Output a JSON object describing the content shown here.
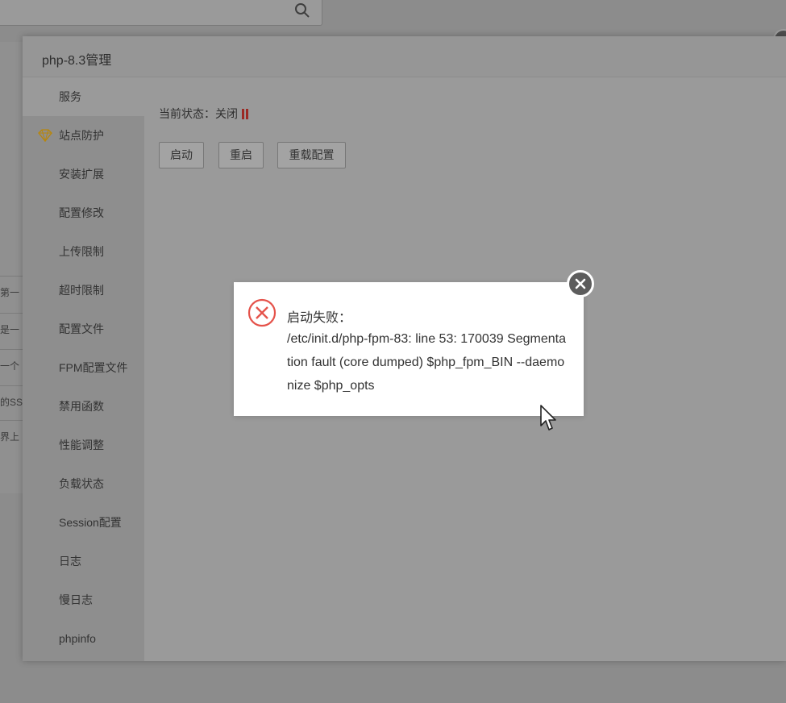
{
  "background": {
    "left_rows": [
      "第一",
      "是一",
      "一个",
      "的SS",
      "界上"
    ]
  },
  "modal": {
    "title": "php-8.3管理",
    "sidebar_items": [
      {
        "label": "服务"
      },
      {
        "label": "站点防护"
      },
      {
        "label": "安装扩展"
      },
      {
        "label": "配置修改"
      },
      {
        "label": "上传限制"
      },
      {
        "label": "超时限制"
      },
      {
        "label": "配置文件"
      },
      {
        "label": "FPM配置文件"
      },
      {
        "label": "禁用函数"
      },
      {
        "label": "性能调整"
      },
      {
        "label": "负载状态"
      },
      {
        "label": "Session配置"
      },
      {
        "label": "日志"
      },
      {
        "label": "慢日志"
      },
      {
        "label": "phpinfo"
      }
    ],
    "status": {
      "label": "当前状态：",
      "value": "关闭"
    },
    "buttons": {
      "start": "启动",
      "restart": "重启",
      "reload": "重载配置"
    }
  },
  "error_dialog": {
    "title": "启动失败：",
    "message": "/etc/init.d/php-fpm-83: line 53: 170039 Segmentation fault (core dumped) $php_fpm_BIN --daemonize $php_opts"
  },
  "colors": {
    "error_red": "#e5534b",
    "status_stopped": "#9b2a24",
    "overlay_gray": "#8c8c8c"
  }
}
